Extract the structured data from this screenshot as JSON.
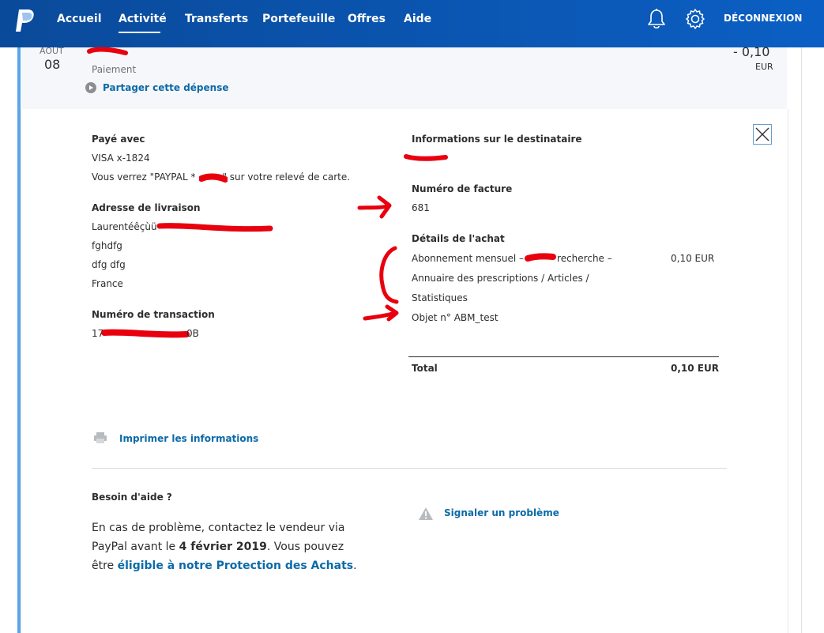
{
  "nav": {
    "items": [
      "Accueil",
      "Activité",
      "Transferts",
      "Portefeuille",
      "Offres",
      "Aide"
    ],
    "active": "Activité",
    "logout": "DÉCONNEXION"
  },
  "summary": {
    "month": "AOUT",
    "day": "08",
    "kind": "Paiement",
    "share": "Partager cette dépense",
    "amount": "- 0,10",
    "currency": "EUR"
  },
  "details": {
    "paid_with_label": "Payé avec",
    "card": "VISA x-1824",
    "statement_prefix": "Vous verrez \"PAYPAL *",
    "statement_suffix": "\" sur votre relevé de carte.",
    "shipping_label": "Adresse de livraison",
    "shipping_name": "Laurentéêçùü",
    "shipping_line2": "fghdfg",
    "shipping_line3": "dfg dfg",
    "shipping_country": "France",
    "txn_label": "Numéro de transaction",
    "txn_prefix": "17",
    "txn_suffix": "0B",
    "recipient_label": "Informations sur le destinataire",
    "invoice_label": "Numéro de facture",
    "invoice": "681",
    "purchase_label": "Détails de l'achat",
    "item_line1_a": "Abonnement mensuel –",
    "item_line1_b": "recherche –",
    "item_line2": "Annuaire des prescriptions / Articles /",
    "item_line3": "Statistiques",
    "item_line4": "Objet n° ABM_test",
    "item_price": "0,10 EUR",
    "total_label": "Total",
    "total_value": "0,10 EUR"
  },
  "actions": {
    "print": "Imprimer les informations",
    "report": "Signaler un problème"
  },
  "help": {
    "title": "Besoin d'aide ?",
    "text_before": "En cas de problème, contactez le vendeur via PayPal avant le ",
    "date": "4 février 2019",
    "text_middle": ". Vous pouvez être ",
    "link": "éligible à notre Protection des Achats",
    "text_after": "."
  },
  "colors": {
    "nav_bg": "#0b5fc4",
    "link": "#0c6aa8",
    "annotation": "#e8000e",
    "accent_bar": "#5aa5e8"
  }
}
